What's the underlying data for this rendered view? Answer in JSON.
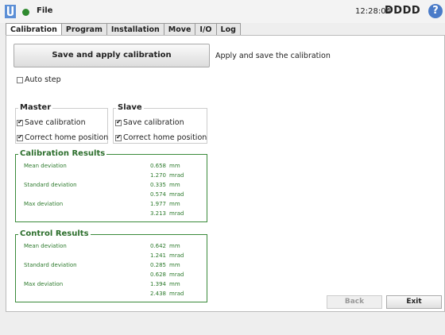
{
  "header": {
    "file_menu": "File",
    "clock": "12:28:04",
    "robot_name": "DDDD",
    "help_glyph": "?",
    "logo_icon": "ur-logo-icon",
    "status_color": "#2f8a2f"
  },
  "tabs": [
    {
      "label": "Calibration",
      "active": true
    },
    {
      "label": "Program"
    },
    {
      "label": "Installation"
    },
    {
      "label": "Move"
    },
    {
      "label": "I/O"
    },
    {
      "label": "Log"
    }
  ],
  "calibration": {
    "save_button": "Save and apply calibration",
    "save_description": "Apply and save the calibration",
    "auto_step": {
      "label": "Auto step",
      "checked": false
    }
  },
  "master": {
    "title": "Master",
    "save_calibration": {
      "label": "Save calibration",
      "checked": true
    },
    "correct_home": {
      "label": "Correct home position",
      "checked": true
    }
  },
  "slave": {
    "title": "Slave",
    "save_calibration": {
      "label": "Save calibration",
      "checked": true
    },
    "correct_home": {
      "label": "Correct home position",
      "checked": true
    }
  },
  "calibration_results": {
    "title": "Calibration Results",
    "rows": [
      {
        "label": "Mean deviation",
        "mm": "0.658",
        "mrad": "1.270"
      },
      {
        "label": "Standard deviation",
        "mm": "0.335",
        "mrad": "0.574"
      },
      {
        "label": "Max deviation",
        "mm": "1.977",
        "mrad": "3.213"
      }
    ]
  },
  "control_results": {
    "title": "Control Results",
    "rows": [
      {
        "label": "Mean deviation",
        "mm": "0.642",
        "mrad": "1.241"
      },
      {
        "label": "Standard deviation",
        "mm": "0.285",
        "mrad": "0.628"
      },
      {
        "label": "Max deviation",
        "mm": "1.394",
        "mrad": "2.438"
      }
    ]
  },
  "units": {
    "mm": "mm",
    "mrad": "mrad"
  },
  "footer": {
    "back": "Back",
    "exit": "Exit"
  }
}
